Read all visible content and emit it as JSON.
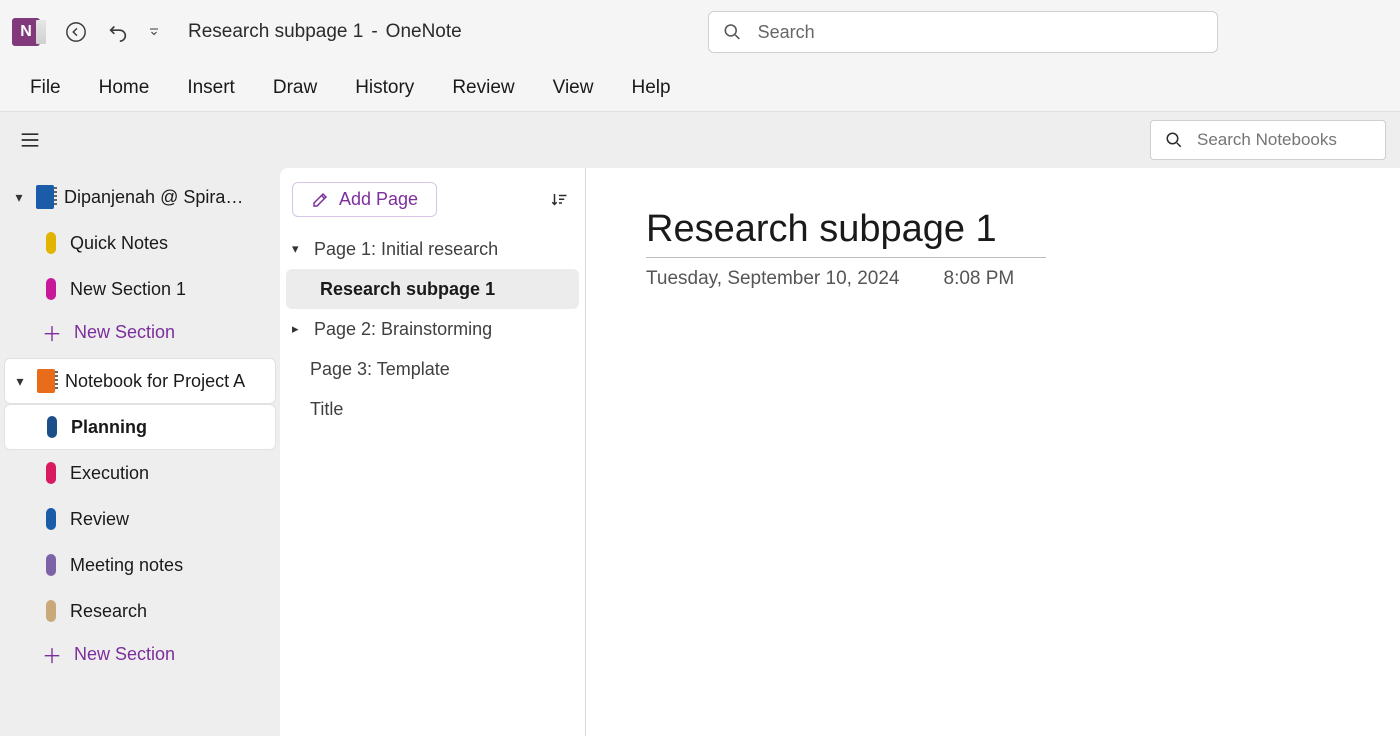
{
  "titlebar": {
    "app_glyph": "N",
    "page_name": "Research subpage 1",
    "app_name": "OneNote",
    "search_placeholder": "Search"
  },
  "ribbon": {
    "tabs": [
      "File",
      "Home",
      "Insert",
      "Draw",
      "History",
      "Review",
      "View",
      "Help"
    ]
  },
  "subbar": {
    "search_notebooks_placeholder": "Search Notebooks"
  },
  "sidebar": {
    "notebooks": [
      {
        "label": "Dipanjenah @ Spiral…",
        "color": "blue",
        "expanded": true,
        "active": false,
        "sections": [
          {
            "label": "Quick Notes",
            "color": "#e0b400",
            "active": false
          },
          {
            "label": "New Section 1",
            "color": "#c81899",
            "active": false
          }
        ],
        "new_section_label": "New Section"
      },
      {
        "label": "Notebook for Project A",
        "color": "orange",
        "expanded": true,
        "active": true,
        "sections": [
          {
            "label": "Planning",
            "color": "#1a4f8a",
            "active": true
          },
          {
            "label": "Execution",
            "color": "#d81a60",
            "active": false
          },
          {
            "label": "Review",
            "color": "#1a5ca8",
            "active": false
          },
          {
            "label": "Meeting notes",
            "color": "#7c63a8",
            "active": false
          },
          {
            "label": "Research",
            "color": "#c9a97a",
            "active": false
          }
        ],
        "new_section_label": "New Section"
      }
    ]
  },
  "pagelist": {
    "add_page_label": "Add Page",
    "pages": [
      {
        "label": "Page 1: Initial research",
        "chevron": "down",
        "indent": 0,
        "selected": false
      },
      {
        "label": "Research subpage 1",
        "chevron": "",
        "indent": 1,
        "selected": true
      },
      {
        "label": "Page 2: Brainstorming",
        "chevron": "right",
        "indent": 0,
        "selected": false
      },
      {
        "label": "Page 3: Template",
        "chevron": "",
        "indent": 0,
        "selected": false
      },
      {
        "label": "Title",
        "chevron": "",
        "indent": 0,
        "selected": false
      }
    ]
  },
  "canvas": {
    "title": "Research subpage 1",
    "date": "Tuesday, September 10, 2024",
    "time": "8:08 PM"
  }
}
